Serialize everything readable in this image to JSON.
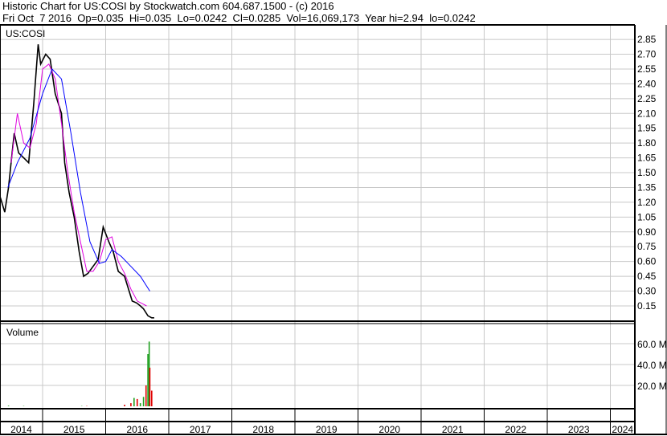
{
  "header": {
    "line1": "Historic Chart for US:COSI by Stockwatch.com 604.687.1500 - (c) 2016",
    "line2": "Fri Oct  7 2016  Op=0.035  Hi=0.035  Lo=0.0242  Cl=0.0285  Vol=16,069,173  Year hi=2.94  lo=0.0242"
  },
  "chart_data": [
    {
      "type": "line",
      "title": "US:COSI",
      "ylim": [
        0,
        3.0
      ],
      "yticks": [
        "2.85",
        "2.70",
        "2.55",
        "2.40",
        "2.25",
        "2.10",
        "1.95",
        "1.80",
        "1.65",
        "1.50",
        "1.35",
        "1.20",
        "1.05",
        "0.90",
        "0.75",
        "0.60",
        "0.45",
        "0.30",
        "0.15"
      ],
      "x_years": [
        "2014",
        "2015",
        "2016",
        "2017",
        "2018",
        "2019",
        "2020",
        "2021",
        "2022",
        "2023",
        "2024"
      ],
      "series": [
        {
          "name": "price",
          "color": "#000000",
          "x": [
            2014.33,
            2014.4,
            2014.46,
            2014.5,
            2014.55,
            2014.62,
            2014.7,
            2014.78,
            2014.86,
            2014.93,
            2014.97,
            2015.05,
            2015.12,
            2015.2,
            2015.3,
            2015.35,
            2015.42,
            2015.5,
            2015.58,
            2015.65,
            2015.72,
            2015.8,
            2015.88,
            2015.96,
            2016.05,
            2016.12,
            2016.2,
            2016.3,
            2016.42,
            2016.49,
            2016.55,
            2016.6,
            2016.67,
            2016.73,
            2016.77
          ],
          "y": [
            1.25,
            1.1,
            1.35,
            1.6,
            1.9,
            1.7,
            1.65,
            1.6,
            2.2,
            2.8,
            2.6,
            2.7,
            2.65,
            2.3,
            2.1,
            1.6,
            1.3,
            1.05,
            0.7,
            0.45,
            0.48,
            0.55,
            0.62,
            0.95,
            0.8,
            0.7,
            0.5,
            0.45,
            0.2,
            0.18,
            0.15,
            0.12,
            0.05,
            0.03,
            0.03
          ]
        },
        {
          "name": "short-ma",
          "color": "#e000e0",
          "x": [
            2014.5,
            2014.6,
            2014.7,
            2014.8,
            2014.9,
            2015.0,
            2015.1,
            2015.2,
            2015.3,
            2015.4,
            2015.5,
            2015.6,
            2015.7,
            2015.8,
            2015.9,
            2016.0,
            2016.1,
            2016.2,
            2016.3,
            2016.4,
            2016.5,
            2016.65
          ],
          "y": [
            1.6,
            2.1,
            1.8,
            1.75,
            2.0,
            2.55,
            2.6,
            2.45,
            2.0,
            1.5,
            1.1,
            0.8,
            0.5,
            0.5,
            0.6,
            0.82,
            0.85,
            0.6,
            0.48,
            0.32,
            0.2,
            0.15
          ]
        },
        {
          "name": "long-ma",
          "color": "#0000ff",
          "x": [
            2014.45,
            2014.6,
            2014.8,
            2015.0,
            2015.15,
            2015.3,
            2015.45,
            2015.6,
            2015.75,
            2015.9,
            2016.0,
            2016.1,
            2016.25,
            2016.4,
            2016.55,
            2016.7
          ],
          "y": [
            1.35,
            1.6,
            1.85,
            2.3,
            2.55,
            2.45,
            1.9,
            1.3,
            0.8,
            0.58,
            0.6,
            0.72,
            0.65,
            0.55,
            0.45,
            0.3
          ]
        }
      ]
    },
    {
      "type": "bar",
      "title": "Volume",
      "ylabel": "",
      "yticks": [
        "60.0 M",
        "40.0 M",
        "20.0 M"
      ],
      "ylim": [
        0,
        80
      ],
      "bars": [
        {
          "x": 2014.46,
          "v": 0.6,
          "color": "#20a020"
        },
        {
          "x": 2014.7,
          "v": 0.3,
          "color": "#20a020"
        },
        {
          "x": 2015.62,
          "v": 0.3,
          "color": "#20a020"
        },
        {
          "x": 2015.7,
          "v": 0.3,
          "color": "#e00000"
        },
        {
          "x": 2016.3,
          "v": 1.5,
          "color": "#e00000"
        },
        {
          "x": 2016.4,
          "v": 3,
          "color": "#e00000"
        },
        {
          "x": 2016.45,
          "v": 8,
          "color": "#20a020"
        },
        {
          "x": 2016.5,
          "v": 7,
          "color": "#e00000"
        },
        {
          "x": 2016.55,
          "v": 3,
          "color": "#20a020"
        },
        {
          "x": 2016.6,
          "v": 9,
          "color": "#20a020"
        },
        {
          "x": 2016.64,
          "v": 20,
          "color": "#e00000"
        },
        {
          "x": 2016.67,
          "v": 50,
          "color": "#20a020"
        },
        {
          "x": 2016.69,
          "v": 62,
          "color": "#20a020"
        },
        {
          "x": 2016.7,
          "v": 37,
          "color": "#e00000"
        },
        {
          "x": 2016.73,
          "v": 15,
          "color": "#e00000"
        }
      ]
    }
  ]
}
